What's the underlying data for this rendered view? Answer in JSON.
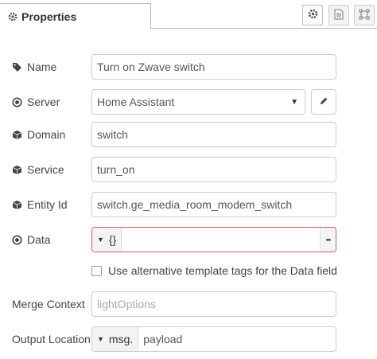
{
  "header": {
    "tab_label": "Properties",
    "tab_icon": "gear-icon",
    "toolbar_icons": [
      "gear-icon",
      "document-icon",
      "frame-icon"
    ]
  },
  "form": {
    "name": {
      "label": "Name",
      "icon": "tag-icon",
      "value": "Turn on Zwave switch"
    },
    "server": {
      "label": "Server",
      "icon": "dot-circle-icon",
      "value": "Home Assistant",
      "edit_icon": "pencil-icon"
    },
    "domain": {
      "label": "Domain",
      "icon": "cube-icon",
      "value": "switch"
    },
    "service": {
      "label": "Service",
      "icon": "cube-icon",
      "value": "turn_on"
    },
    "entity_id": {
      "label": "Entity Id",
      "icon": "cube-icon",
      "value": "switch.ge_media_room_modem_switch"
    },
    "data": {
      "label": "Data",
      "icon": "dot-circle-icon",
      "type": "{}",
      "value": "",
      "more": "•••"
    },
    "alt_tags": {
      "label": "Use alternative template tags for the Data field",
      "checked": false
    },
    "merge_context": {
      "label": "Merge Context",
      "placeholder": "lightOptions"
    },
    "output_location": {
      "label": "Output Location",
      "type": "msg.",
      "value": "payload"
    }
  },
  "colors": {
    "error_border": "#d65c5c",
    "border": "#cccccc"
  }
}
